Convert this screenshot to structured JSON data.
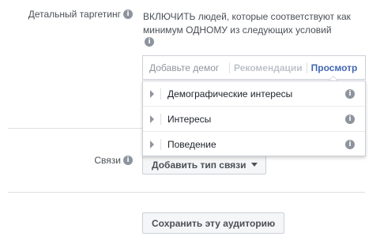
{
  "targeting": {
    "label": "Детальный таргетинг",
    "description": "ВКЛЮЧИТЬ людей, которые соответствуют как минимум ОДНОМУ из следующих условий",
    "search_placeholder": "Добавьте демог",
    "recommendations_label": "Рекомендации",
    "browse_label": "Просмотр"
  },
  "dropdown": {
    "items": [
      {
        "label": "Демографические интересы"
      },
      {
        "label": "Интересы"
      },
      {
        "label": "Поведение"
      }
    ]
  },
  "connections": {
    "label": "Связи",
    "button_label": "Добавить тип связи"
  },
  "actions": {
    "save_label": "Сохранить эту аудиторию"
  },
  "colors": {
    "accent": "#4267b2",
    "text": "#4b4f56",
    "muted": "#90949c",
    "border": "#ccd0d5"
  }
}
